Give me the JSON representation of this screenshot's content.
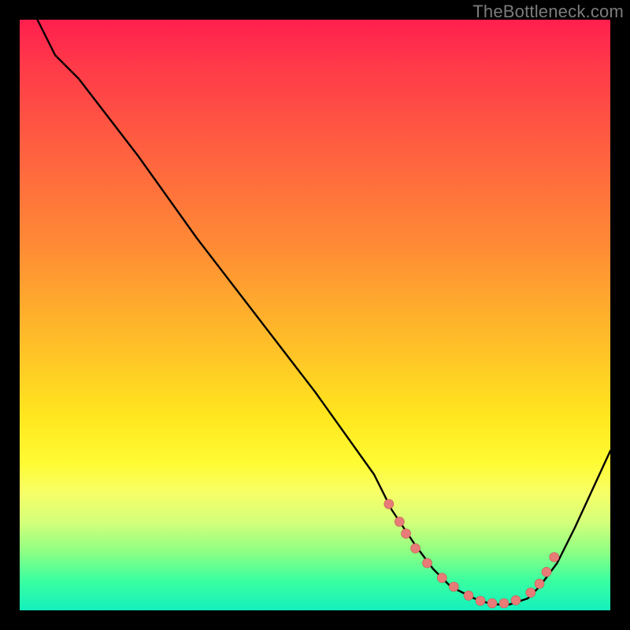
{
  "watermark": "TheBottleneck.com",
  "colors": {
    "background": "#000000",
    "curve": "#000000",
    "dot_fill": "#e77b77",
    "dot_stroke": "#c95550",
    "watermark": "#7c7c7c"
  },
  "chart_data": {
    "type": "line",
    "title": "",
    "xlabel": "",
    "ylabel": "",
    "xlim": [
      0,
      100
    ],
    "ylim": [
      0,
      100
    ],
    "series": [
      {
        "name": "curve",
        "x": [
          3,
          6,
          10,
          20,
          30,
          40,
          50,
          60,
          63,
          67,
          70,
          73,
          77,
          80,
          83,
          86,
          88,
          91,
          94,
          100
        ],
        "y": [
          100,
          94,
          90,
          77,
          63,
          50,
          37,
          23,
          17,
          11,
          7,
          4,
          2,
          1,
          1,
          2,
          4,
          8,
          14,
          27
        ]
      }
    ],
    "markers": {
      "name": "highlight-dots",
      "x": [
        62.5,
        64.3,
        65.4,
        67.0,
        69.0,
        71.5,
        73.5,
        76.0,
        78.0,
        80.0,
        82.0,
        84.0,
        86.5,
        88.0,
        89.2,
        90.5
      ],
      "y": [
        18.0,
        15.0,
        13.0,
        10.5,
        8.0,
        5.5,
        4.0,
        2.5,
        1.6,
        1.2,
        1.2,
        1.7,
        3.0,
        4.5,
        6.5,
        9.0
      ]
    },
    "background": "vertical-gradient",
    "background_stops": [
      {
        "pos": 0.0,
        "color": "#ff1f4e"
      },
      {
        "pos": 0.22,
        "color": "#ff6040"
      },
      {
        "pos": 0.55,
        "color": "#ffbf28"
      },
      {
        "pos": 0.75,
        "color": "#fffb33"
      },
      {
        "pos": 0.9,
        "color": "#8fff83"
      },
      {
        "pos": 1.0,
        "color": "#14f0bd"
      }
    ]
  }
}
